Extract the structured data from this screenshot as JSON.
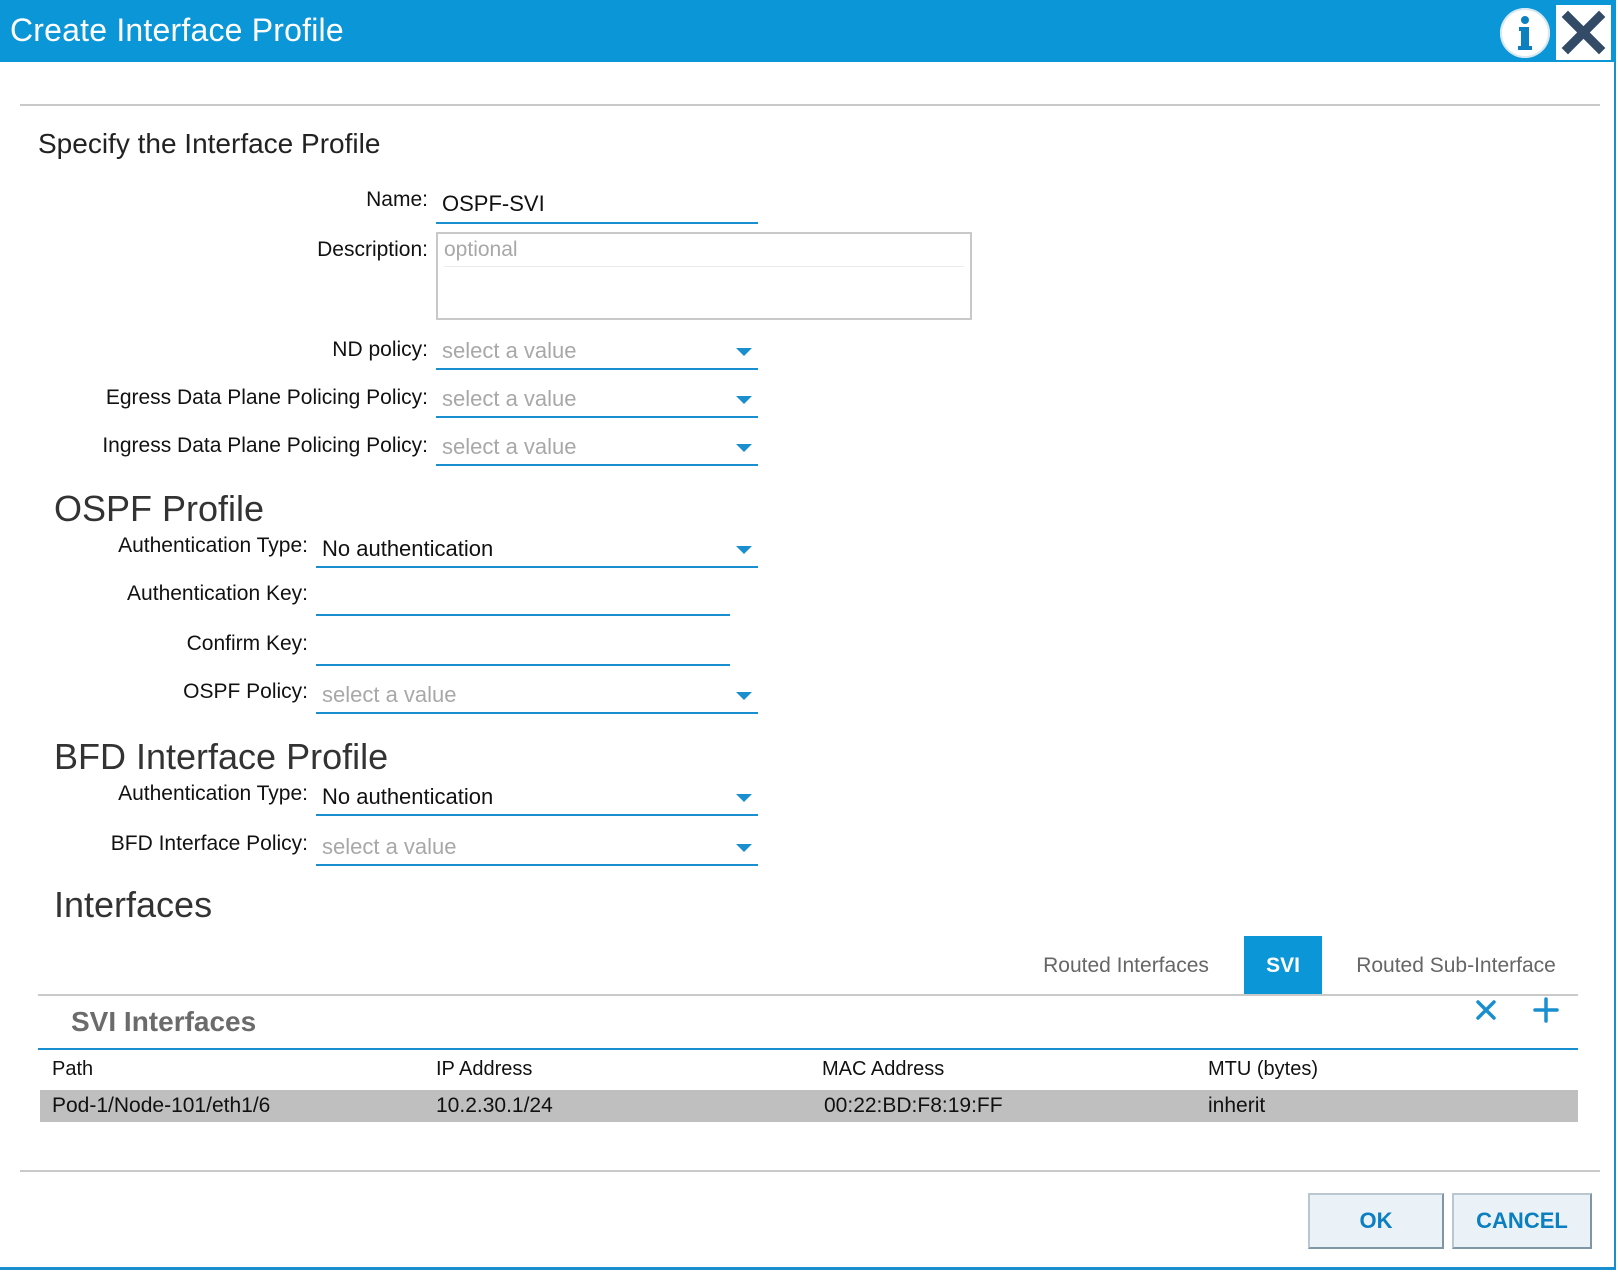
{
  "dialog": {
    "title": "Create Interface Profile",
    "info_icon": "info-icon",
    "close_icon": "close-icon"
  },
  "form": {
    "section_title": "Specify the Interface Profile",
    "name": {
      "label": "Name:",
      "value": "OSPF-SVI"
    },
    "description": {
      "label": "Description:",
      "placeholder": "optional",
      "value": ""
    },
    "nd_policy": {
      "label": "ND policy:",
      "value": "select a value"
    },
    "egress_policy": {
      "label": "Egress Data Plane Policing Policy:",
      "value": "select a value"
    },
    "ingress_policy": {
      "label": "Ingress Data Plane Policing Policy:",
      "value": "select a value"
    }
  },
  "ospf": {
    "title": "OSPF Profile",
    "auth_type": {
      "label": "Authentication Type:",
      "value": "No authentication"
    },
    "auth_key": {
      "label": "Authentication Key:",
      "value": ""
    },
    "confirm_key": {
      "label": "Confirm Key:",
      "value": ""
    },
    "policy": {
      "label": "OSPF Policy:",
      "value": "select a value"
    }
  },
  "bfd": {
    "title": "BFD Interface Profile",
    "auth_type": {
      "label": "Authentication Type:",
      "value": "No authentication"
    },
    "policy": {
      "label": "BFD Interface Policy:",
      "value": "select a value"
    }
  },
  "interfaces": {
    "title": "Interfaces",
    "tabs": [
      {
        "label": "Routed Interfaces",
        "active": false
      },
      {
        "label": "SVI",
        "active": true
      },
      {
        "label": "Routed Sub-Interface",
        "active": false
      }
    ],
    "panel_title": "SVI Interfaces",
    "delete_icon": "x-icon",
    "add_icon": "plus-icon",
    "columns": [
      "Path",
      "IP Address",
      "MAC Address",
      "MTU (bytes)"
    ],
    "rows": [
      [
        "Pod-1/Node-101/eth1/6",
        "10.2.30.1/24",
        "00:22:BD:F8:19:FF",
        "inherit"
      ]
    ]
  },
  "footer": {
    "ok_label": "OK",
    "cancel_label": "CANCEL"
  },
  "colors": {
    "accent": "#0b96d8",
    "field_line": "#1a8fd0",
    "placeholder": "#a8a8a8",
    "selected_row": "#bfbfbf"
  }
}
